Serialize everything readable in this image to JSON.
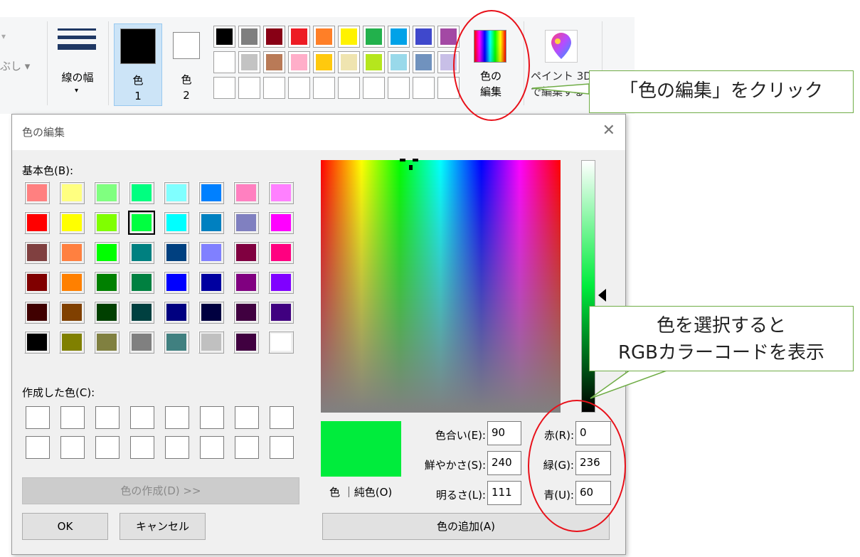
{
  "ribbon": {
    "left_clip_label": "ぶし ▾",
    "left_clip_top": "▾",
    "line_width_label": "線の幅",
    "line_width_caret": "▾",
    "color1_label": "色\n1",
    "color1_top": "色",
    "color1_num": "1",
    "color2_top": "色",
    "color2_num": "2",
    "edit_colors_line1": "色の",
    "edit_colors_line2": "編集",
    "paint3d_line1": "ペイント 3D",
    "paint3d_line2": "で編集する",
    "palette_row1": [
      "#000000",
      "#7f7f7f",
      "#880015",
      "#ed1c24",
      "#ff7f27",
      "#fff200",
      "#22b14c",
      "#00a2e8",
      "#3f48cc",
      "#a349a4"
    ],
    "palette_row2": [
      "#ffffff",
      "#c3c3c3",
      "#b97a57",
      "#ffaec9",
      "#ffc90e",
      "#efe4b0",
      "#b5e61d",
      "#99d9ea",
      "#7092be",
      "#c8bfe7"
    ]
  },
  "dialog": {
    "title": "色の編集",
    "close_glyph": "✕",
    "basic_colors_label": "基本色(B):",
    "custom_colors_label": "作成した色(C):",
    "define_custom_button": "色の作成(D) >>",
    "ok_button": "OK",
    "cancel_button": "キャンセル",
    "add_color_button": "色の追加(A)",
    "preview_label": "色 ｜純色(O)",
    "basic_colors": [
      [
        "#ff8080",
        "#ffff80",
        "#80ff80",
        "#00ff80",
        "#80ffff",
        "#0080ff",
        "#ff80c0",
        "#ff80ff"
      ],
      [
        "#ff0000",
        "#ffff00",
        "#80ff00",
        "#00ff40",
        "#00ffff",
        "#0080c0",
        "#8080c0",
        "#ff00ff"
      ],
      [
        "#804040",
        "#ff8040",
        "#00ff00",
        "#008080",
        "#004080",
        "#8080ff",
        "#800040",
        "#ff0080"
      ],
      [
        "#800000",
        "#ff8000",
        "#008000",
        "#008040",
        "#0000ff",
        "#0000a0",
        "#800080",
        "#8000ff"
      ],
      [
        "#400000",
        "#804000",
        "#004000",
        "#004040",
        "#000080",
        "#000040",
        "#400040",
        "#400080"
      ],
      [
        "#000000",
        "#808000",
        "#808040",
        "#808080",
        "#408080",
        "#c0c0c0",
        "#400040",
        "#ffffff"
      ]
    ],
    "selected_basic": [
      1,
      3
    ],
    "fields": {
      "hue_label": "色合い(E):",
      "hue_value": "90",
      "sat_label": "鮮やかさ(S):",
      "sat_value": "240",
      "lum_label": "明るさ(L):",
      "lum_value": "111",
      "red_label": "赤(R):",
      "red_value": "0",
      "green_label": "緑(G):",
      "green_value": "236",
      "blue_label": "青(U):",
      "blue_value": "60"
    },
    "current_color": "#00ec3c"
  },
  "annotations": {
    "callout1": "「色の編集」をクリック",
    "callout2_line1": "色を選択すると",
    "callout2_line2": "RGBカラーコードを表示",
    "accent_color": "#70ad47",
    "circle_color": "#e8111a"
  }
}
